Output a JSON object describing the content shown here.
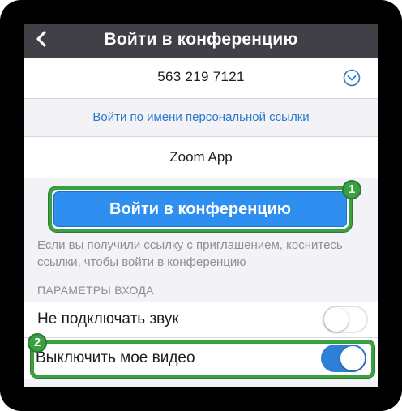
{
  "header": {
    "title": "Войти в конференцию",
    "back_icon": "chevron-left-icon"
  },
  "meeting": {
    "id": "563 219 7121",
    "dropdown_icon": "chevron-down-circle-icon"
  },
  "personal_link": {
    "label": "Войти по имени персональной ссылки"
  },
  "display_name": {
    "value": "Zoom App"
  },
  "join": {
    "label": "Войти в конференцию",
    "color": "#2e8ff0"
  },
  "hint": {
    "text": "Если вы получили ссылку с приглашением, коснитесь ссылки, чтобы войти в конференцию"
  },
  "options": {
    "header": "ПАРАМЕТРЫ ВХОДА",
    "items": [
      {
        "label": "Не подключать звук",
        "enabled": false
      },
      {
        "label": "Выключить мое видео",
        "enabled": true
      }
    ]
  },
  "annotations": {
    "badge_1": "1",
    "badge_2": "2",
    "highlight_color": "#3aa142"
  }
}
